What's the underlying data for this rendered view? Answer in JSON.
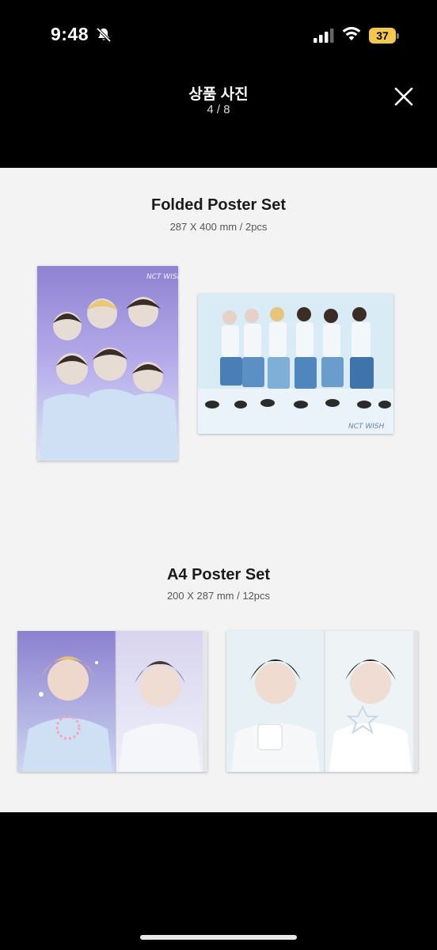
{
  "status": {
    "time": "9:48",
    "battery": "37",
    "battery_color": "#f2c94c"
  },
  "header": {
    "title": "상품 사진",
    "counter": "4 / 8",
    "close_icon": "close-icon"
  },
  "sections": [
    {
      "title": "Folded Poster Set",
      "subtitle": "287 X 400 mm / 2pcs"
    },
    {
      "title": "A4 Poster Set",
      "subtitle": "200 X 287 mm / 12pcs"
    }
  ],
  "poster_logo_text": "NCT WISH",
  "colors": {
    "background": "#000000",
    "content_bg": "#f3f3f3",
    "title_text": "#1b1b1b",
    "lavender": "#9b8fd8",
    "sky": "#cfe3f2"
  }
}
